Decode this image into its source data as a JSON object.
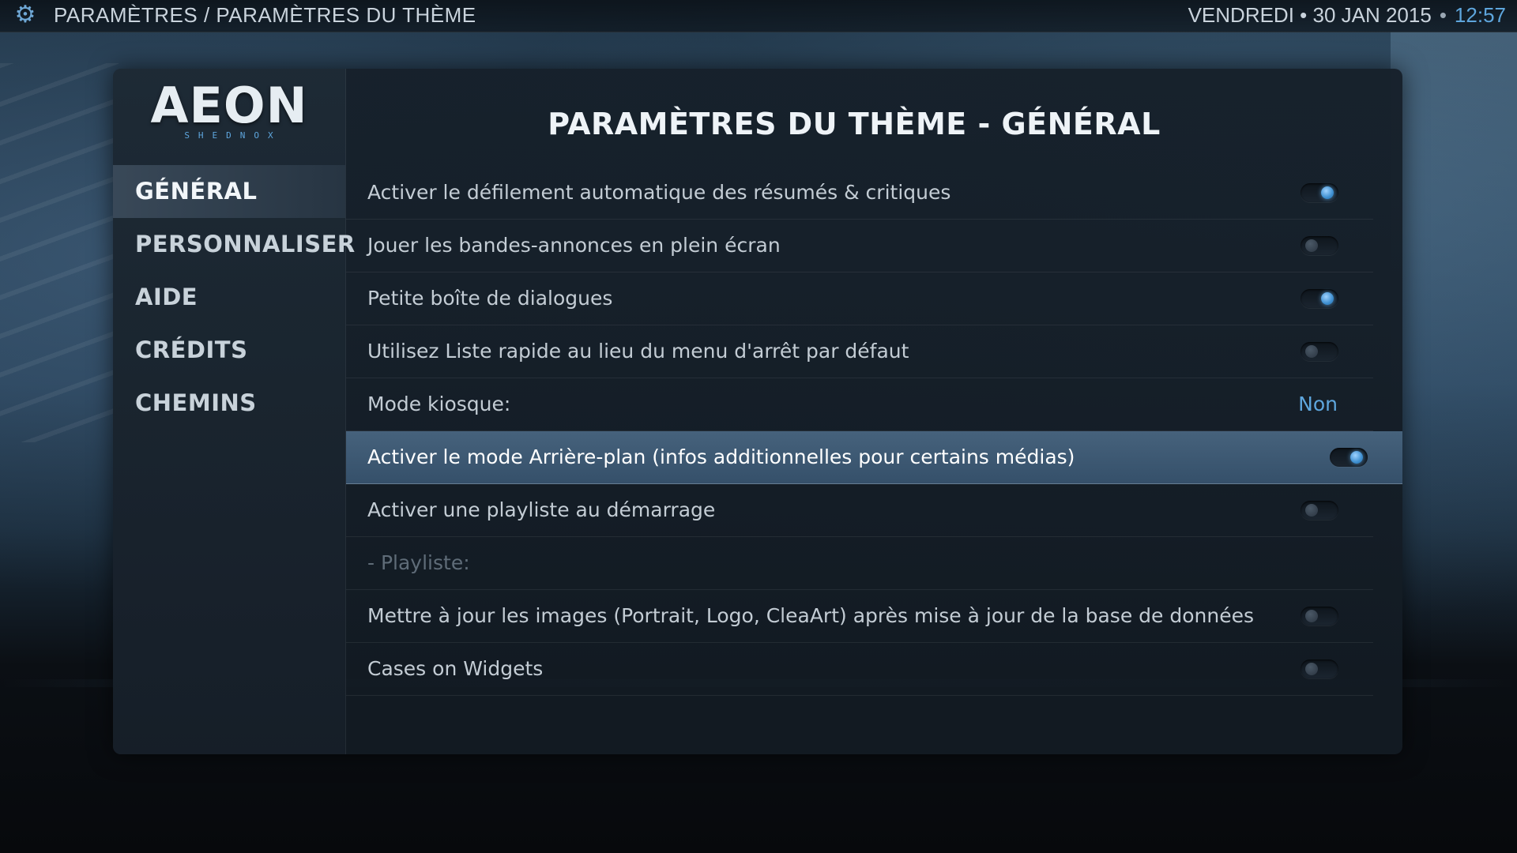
{
  "topbar": {
    "breadcrumb": "PARAMÈTRES / PARAMÈTRES DU THÈME",
    "day_date": "VENDREDI • 30 JAN 2015",
    "separator": "•",
    "time": "12:57"
  },
  "logo": {
    "word": "AEON",
    "sub": "SHEDNOX"
  },
  "sidebar": {
    "items": [
      {
        "label": "GÉNÉRAL",
        "active": true
      },
      {
        "label": "PERSONNALISER",
        "active": false
      },
      {
        "label": "AIDE",
        "active": false
      },
      {
        "label": "CRÉDITS",
        "active": false
      },
      {
        "label": "CHEMINS",
        "active": false
      }
    ]
  },
  "main": {
    "title": "PARAMÈTRES DU THÈME - GÉNÉRAL",
    "settings": [
      {
        "label": "Activer le défilement automatique des résumés & critiques",
        "type": "toggle",
        "state": "on"
      },
      {
        "label": "Jouer les bandes-annonces en plein écran",
        "type": "toggle",
        "state": "off"
      },
      {
        "label": "Petite boîte de dialogues",
        "type": "toggle",
        "state": "on"
      },
      {
        "label": "Utilisez Liste rapide au lieu du menu d'arrêt par défaut",
        "type": "toggle",
        "state": "off"
      },
      {
        "label": "Mode kiosque:",
        "type": "value",
        "value": "Non"
      },
      {
        "label": "Activer le mode Arrière-plan (infos additionnelles pour certains médias)",
        "type": "toggle",
        "state": "on",
        "focused": true
      },
      {
        "label": "Activer une playliste au démarrage",
        "type": "toggle",
        "state": "off"
      },
      {
        "label": "- Playliste:",
        "type": "disabled"
      },
      {
        "label": "Mettre à jour les images (Portrait, Logo, CleaArt) après mise à jour de la base de données",
        "type": "toggle",
        "state": "off"
      },
      {
        "label": "Cases on Widgets",
        "type": "toggle",
        "state": "off"
      }
    ]
  },
  "colors": {
    "accent": "#5ea6dd",
    "focus_row": "#3f5a74",
    "panel": "#16202a"
  },
  "icons": {
    "settings": "gear-icon"
  }
}
